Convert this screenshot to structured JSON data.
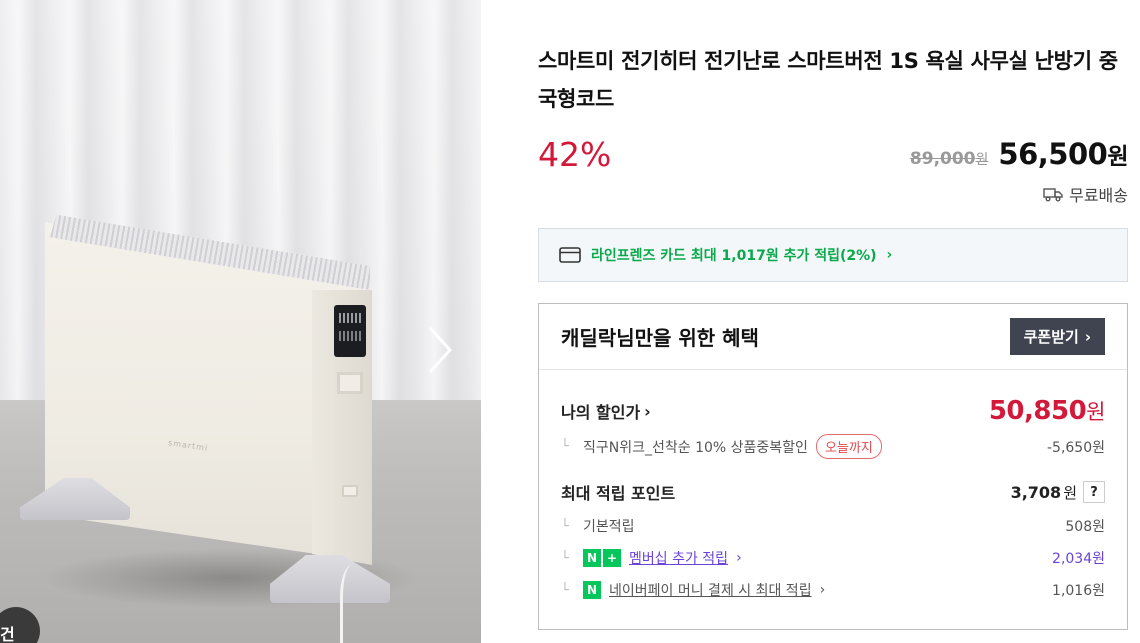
{
  "gallery": {
    "product_brand_mark": "smartmi",
    "next_arrow_icon": "chevron-right-icon",
    "corner_badge_text": "건"
  },
  "product": {
    "title": "스마트미 전기히터 전기난로 스마트버전 1S 욕실 사무실 난방기 중국형코드",
    "discount_rate": "42%",
    "original_price": "89,000",
    "original_unit": "원",
    "sale_price": "56,500",
    "sale_unit": "원",
    "delivery_icon": "truck-icon",
    "delivery_text": "무료배송"
  },
  "card_promo": {
    "icon": "credit-card-icon",
    "text": "라인프렌즈 카드 최대 1,017원 추가 적립(2%)",
    "chevron": "›"
  },
  "benefit": {
    "title": "캐딜락님만을 위한 혜택",
    "coupon_button": "쿠폰받기",
    "coupon_chevron": "›",
    "my_price_label": "나의 할인가",
    "my_price_chevron": "›",
    "my_price_value": "50,850",
    "my_price_unit": "원",
    "discount_detail": "직구N위크_선착순 10% 상품중복할인",
    "discount_pill": "오늘까지",
    "discount_amount": "-5,650원",
    "max_points_label": "최대 적립 포인트",
    "max_points_value": "3,708",
    "max_points_unit": "원",
    "help": "?",
    "basic_label": "기본적립",
    "basic_value": "508원",
    "membership_label": "멤버십 추가 적립",
    "membership_chevron": "›",
    "membership_value": "2,034원",
    "npay_label": "네이버페이 머니 결제 시 최대 적립",
    "npay_chevron": "›",
    "npay_value": "1,016원",
    "tree_glyph": "└"
  },
  "colors": {
    "accent_red": "#d3193a",
    "naver_green": "#03c75a",
    "membership_purple": "#6b43d8",
    "coupon_button_bg": "#404451"
  }
}
